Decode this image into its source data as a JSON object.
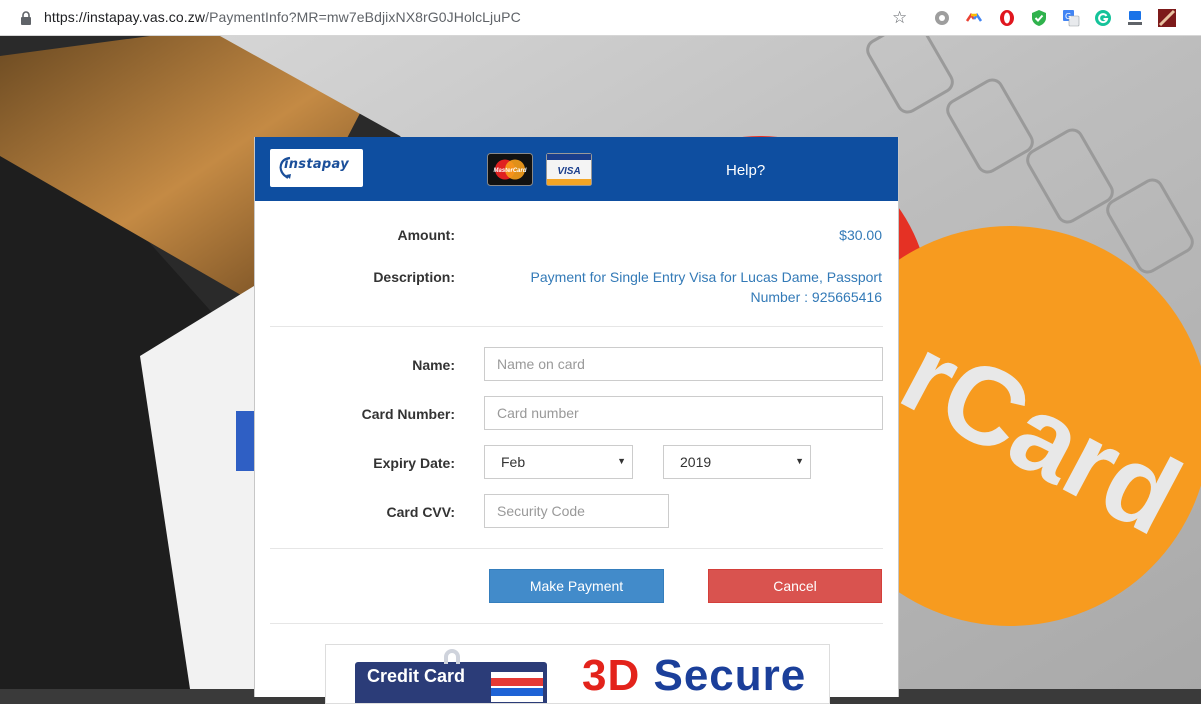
{
  "browser": {
    "url_host": "https://instapay.vas.co.zw",
    "url_path": "/PaymentInfo?MR=mw7eBdjixNX8rG0JHolcLjuPC",
    "icons": [
      "lock-icon",
      "bookmark-star-icon",
      "extension-grey-icon",
      "extension-google-icon",
      "opera-icon",
      "shield-icon",
      "translate-icon",
      "grammarly-icon",
      "download-icon",
      "profile-avatar-icon"
    ]
  },
  "header": {
    "logo_text": "instapay",
    "card_logos": [
      "MasterCard",
      "VISA"
    ],
    "help_label": "Help?"
  },
  "summary": {
    "amount_label": "Amount:",
    "amount_value": "$30.00",
    "description_label": "Description:",
    "description_line1": "Payment for Single Entry Visa for Lucas Dame, Passport",
    "description_line2": "Number : 925665416"
  },
  "form": {
    "name_label": "Name:",
    "name_placeholder": "Name on card",
    "card_label": "Card Number:",
    "card_placeholder": "Card number",
    "expiry_label": "Expiry Date:",
    "expiry_month": "Feb",
    "expiry_year": "2019",
    "cvv_label": "Card CVV:",
    "cvv_placeholder": "Security Code"
  },
  "actions": {
    "pay_label": "Make Payment",
    "cancel_label": "Cancel"
  },
  "footer": {
    "badge_text": "Credit Card",
    "secure_number": "3D",
    "secure_word": "Secure"
  },
  "colors": {
    "header_blue": "#0e4ea0",
    "link_blue": "#337ab7",
    "primary_button": "#428bca",
    "danger_button": "#d9534f"
  }
}
